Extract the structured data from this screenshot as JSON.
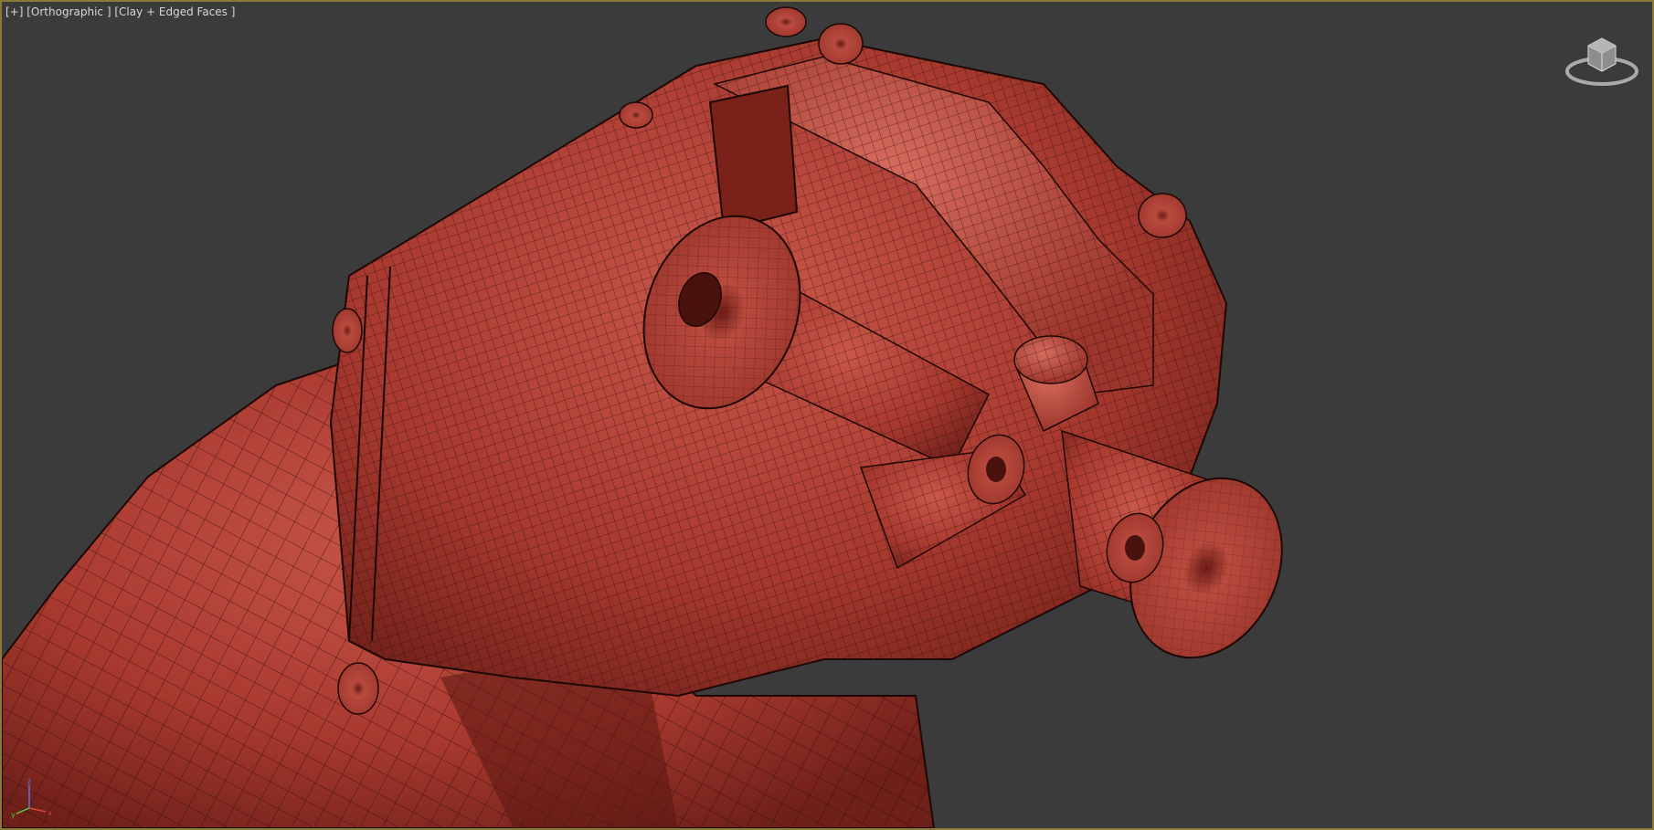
{
  "viewport": {
    "menu_label": "[+]",
    "view_label": "[Orthographic ]",
    "shading_label": "[Clay + Edged Faces ]"
  },
  "axes": {
    "x": "x",
    "y": "y",
    "z": "z"
  },
  "colors": {
    "background": "#3b3b3b",
    "active_border": "#8a7a3a",
    "clay": "#b8473c",
    "wire": "#2a0c08",
    "label_text": "#d8d8d8"
  }
}
